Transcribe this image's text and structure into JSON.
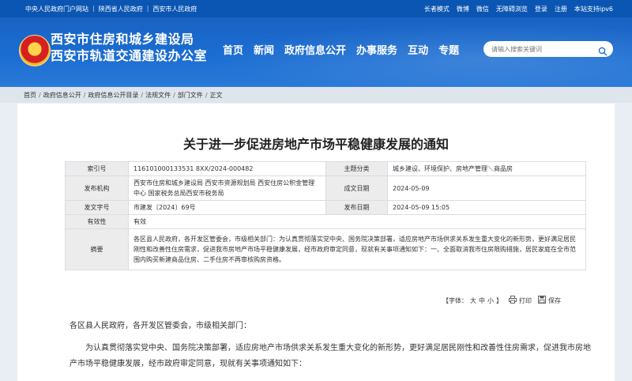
{
  "topbar": {
    "left_links": [
      "中央人民政府门户网站",
      "陕西省人民政府",
      "西安市人民政府"
    ],
    "right_links": [
      "长者模式",
      "微博",
      "微信",
      "无障碍浏览",
      "登录",
      "注册",
      "本站支持ipv6"
    ]
  },
  "header": {
    "site_name_line1": "西安市住房和城乡建设局",
    "site_name_line2": "西安市轨道交通建设办公室",
    "nav": [
      "首页",
      "新闻",
      "政府信息公开",
      "办事服务",
      "互动",
      "专题"
    ],
    "search_placeholder": "请输入搜索关键词"
  },
  "breadcrumb": [
    "首页",
    "政府信息公开",
    "政府信息公开目录",
    "法规文件",
    "部门文件",
    "正文"
  ],
  "article": {
    "title": "关于进一步促进房地产市场平稳健康发展的通知",
    "meta": {
      "index_label": "索引号",
      "index_value": "116101000133531 8XX/2024-000482",
      "topic_label": "主题分类",
      "topic_value": "城乡建设、环境保护、房地产管理＼商品房",
      "issuer_label": "发布机构",
      "issuer_value": "西安市住房和城乡建设局 西安市资源规划局 西安住房公积金管理中心 国家税务总局西安市税务局",
      "date_label": "成文日期",
      "date_value": "2024-05-09",
      "docno_label": "发文字号",
      "docno_value": "市建发〔2024〕69号",
      "pubdate_label": "发布日期",
      "pubdate_value": "2024-05-09 15:05",
      "validity_label": "有效性",
      "validity_value": "有效",
      "abstract_label": "摘要",
      "abstract_value": "各区县人民政府，各开发区管委会，市级相关部门：为认真贯彻落实党中央、国务院决策部署，适应房地产市场供求关系发生重大变化的新形势，更好满足居民刚性和改善性住房需求，促进我市房地产市场平稳健康发展，经市政府审定同意，现就有关事项通知如下：一、全面取消我市住房限购措施，居民家庭在全市范围内购买新建商品住房、二手住房不再审核购房资格。"
    },
    "tools": {
      "font_label": "【字体：",
      "font_large": "大",
      "font_medium": "中",
      "font_small": "小",
      "font_end": "】",
      "print_label": "打印",
      "save_label": "保存"
    },
    "paragraph1": "各区县人民政府，各开发区管委会，市级相关部门：",
    "paragraph2": "为认真贯彻落实党中央、国务院决策部署，适应房地产市场供求关系发生重大变化的新形势，更好满足居民刚性和改善性住房需求，促进我市房地产市场平稳健康发展，经市政府审定同意，现就有关事项通知如下："
  }
}
